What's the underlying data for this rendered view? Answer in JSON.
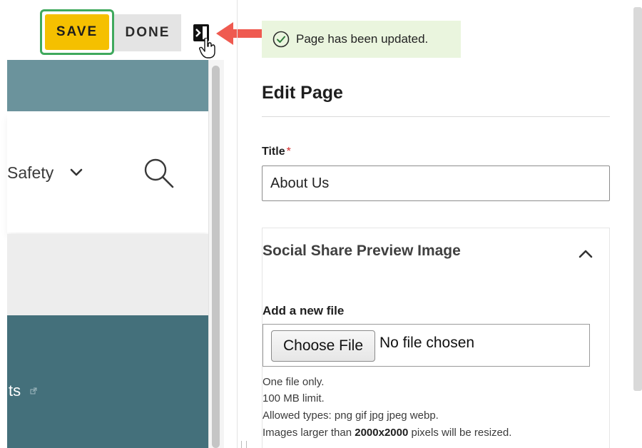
{
  "toolbar": {
    "save_label": "SAVE",
    "done_label": "DONE"
  },
  "preview": {
    "nav_item_partial": "Safety",
    "link_partial": "ts"
  },
  "notification": {
    "message": "Page has been updated."
  },
  "edit_panel": {
    "heading": "Edit Page",
    "title_field": {
      "label": "Title",
      "required_marker": "*",
      "value": "About Us"
    },
    "social_share": {
      "heading": "Social Share Preview Image",
      "expanded": true,
      "add_file_label": "Add a new file",
      "choose_button_label": "Choose File",
      "file_status": "No file chosen",
      "help_line1": "One file only.",
      "help_line2": "100 MB limit.",
      "help_line3": "Allowed types: png gif jpg jpeg webp.",
      "help_line4_prefix": "Images larger than ",
      "help_line4_bold": "2000x2000",
      "help_line4_suffix": " pixels will be resized."
    }
  },
  "colors": {
    "save_button": "#f5c000",
    "save_focus_ring": "#3fa95d",
    "toast_background": "#eaf5de",
    "callout_arrow": "#ef5a50",
    "preview_header": "#6b939c",
    "preview_footer": "#44707b"
  },
  "icons": {
    "collapse": "panel-collapse-icon",
    "toast": "check-circle-icon",
    "search": "search-icon",
    "chevron": "chevron-up-icon",
    "pointer": "hand-pointer-icon",
    "arrow": "callout-arrow-icon"
  }
}
